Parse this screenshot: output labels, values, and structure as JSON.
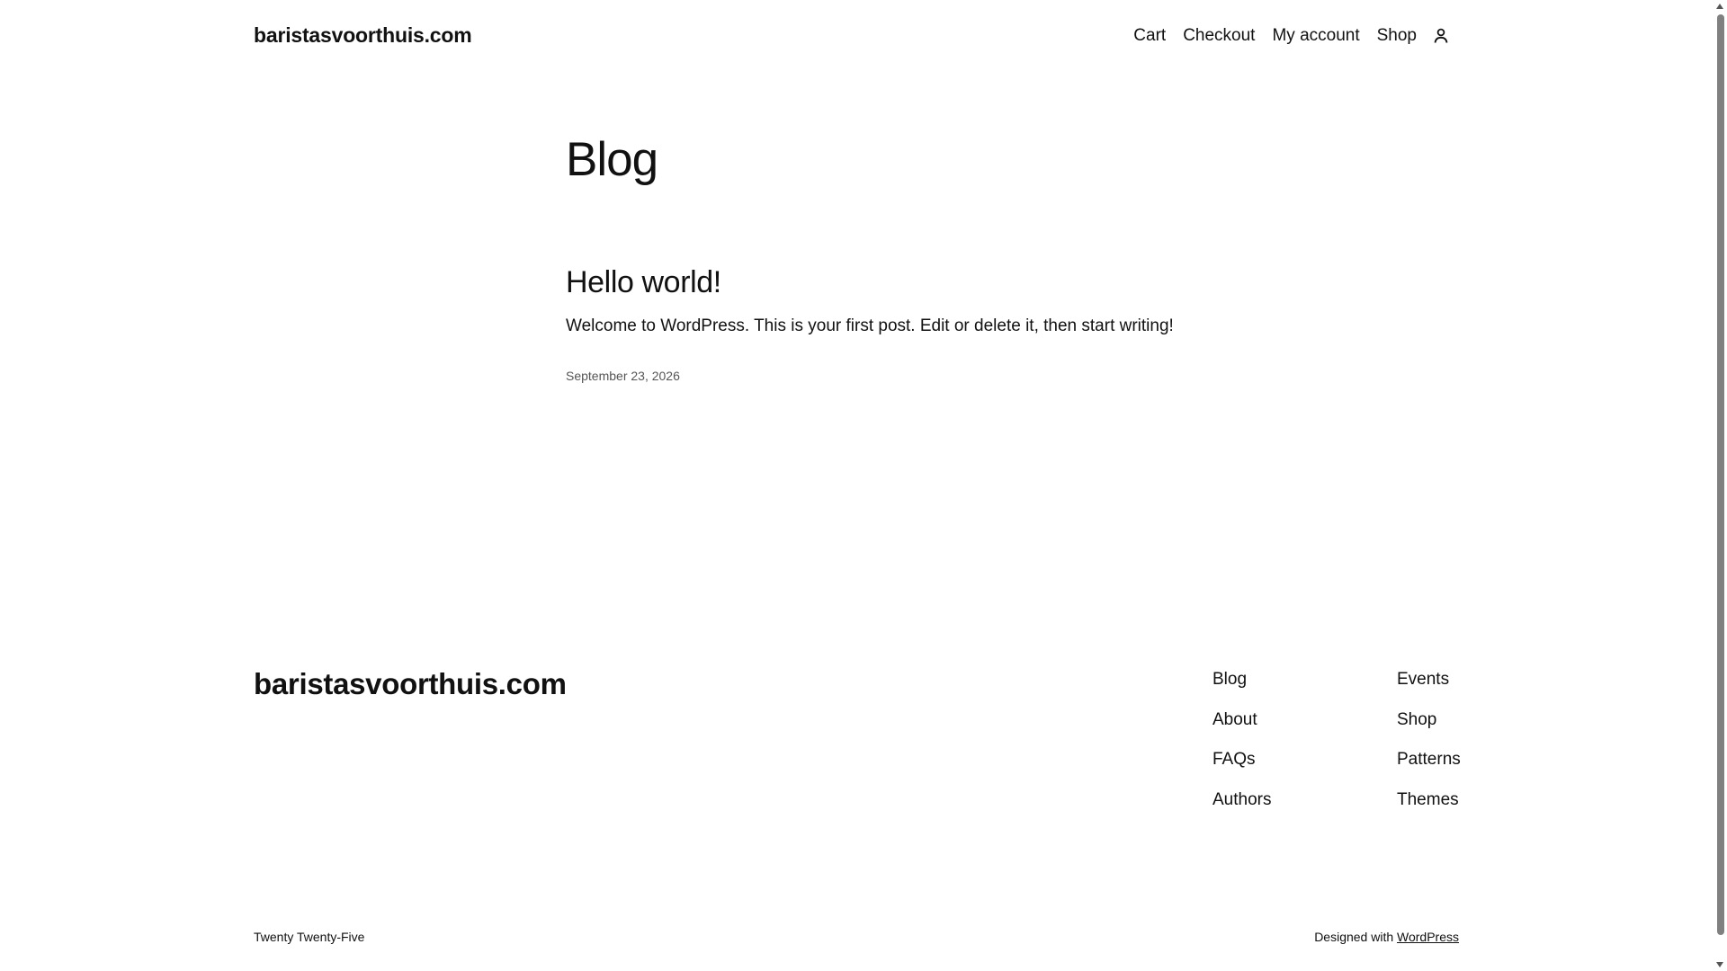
{
  "header": {
    "site_title": "baristasvoorthuis.com",
    "nav": [
      {
        "label": "Cart"
      },
      {
        "label": "Checkout"
      },
      {
        "label": "My account"
      },
      {
        "label": "Shop"
      }
    ],
    "account_icon": "person-icon"
  },
  "main": {
    "heading": "Blog",
    "post": {
      "title": "Hello world!",
      "excerpt": "Welcome to WordPress. This is your first post. Edit or delete it, then start writing!",
      "date": "September 23, 2026"
    }
  },
  "footer": {
    "site_title": "baristasvoorthuis.com",
    "col1": [
      "Blog",
      "About",
      "FAQs",
      "Authors"
    ],
    "col2": [
      "Events",
      "Shop",
      "Patterns",
      "Themes"
    ],
    "theme_name": "Twenty Twenty-Five",
    "credit_prefix": "Designed with",
    "credit_link": "WordPress"
  }
}
